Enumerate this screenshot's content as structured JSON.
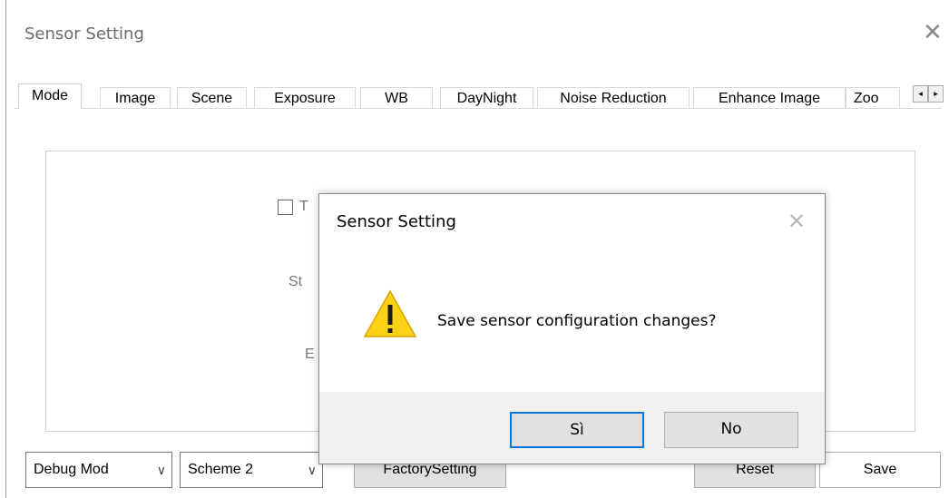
{
  "window": {
    "title": "Sensor Setting",
    "close_glyph": "✕"
  },
  "tabs": [
    {
      "label": "Mode",
      "active": true
    },
    {
      "label": "Image"
    },
    {
      "label": "Scene"
    },
    {
      "label": "Exposure"
    },
    {
      "label": "WB"
    },
    {
      "label": "DayNight"
    },
    {
      "label": "Noise Reduction"
    },
    {
      "label": "Enhance Image"
    },
    {
      "label": "Zoo"
    }
  ],
  "tab_scroll": {
    "left_glyph": "◂",
    "right_glyph": "▸"
  },
  "panel": {
    "partial_text_1": "T",
    "partial_text_2": "St",
    "partial_text_3": "E"
  },
  "bottom_bar": {
    "debug_mode": "Debug Mod",
    "scheme": "Scheme 2",
    "factory_setting": "FactorySetting",
    "reset": "Reset",
    "save": "Save",
    "chevron_glyph": "∨"
  },
  "dialog": {
    "title": "Sensor Setting",
    "close_glyph": "✕",
    "message": "Save sensor configuration changes?",
    "icon": "warning-icon",
    "yes_label": "Sì",
    "no_label": "No"
  },
  "colors": {
    "accent": "#0078d7",
    "warning": "#fcd116"
  }
}
